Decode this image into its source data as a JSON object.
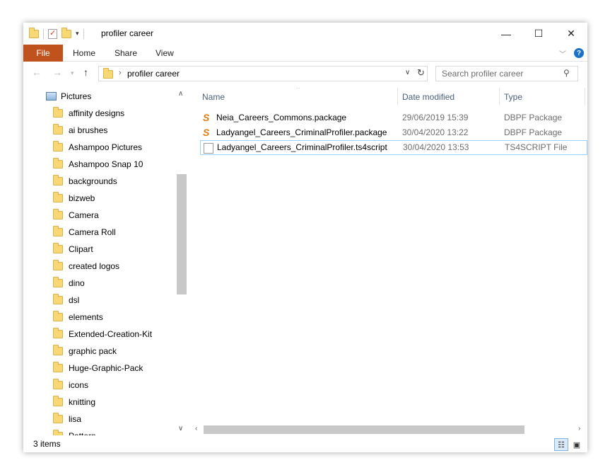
{
  "window": {
    "title": "profiler career",
    "controls": {
      "minimize": "—",
      "maximize": "☐",
      "close": "✕"
    }
  },
  "ribbon": {
    "file_tab": "File",
    "tabs": [
      "Home",
      "Share",
      "View"
    ]
  },
  "address": {
    "path": "profiler career",
    "search_placeholder": "Search profiler career"
  },
  "nav": {
    "root": "Pictures",
    "folders": [
      "affinity designs",
      "ai brushes",
      "Ashampoo Pictures",
      "Ashampoo Snap 10",
      "backgrounds",
      "bizweb",
      "Camera",
      "Camera Roll",
      "Clipart",
      "created logos",
      "dino",
      "dsl",
      "elements",
      "Extended-Creation-Kit",
      "graphic pack",
      "Huge-Graphic-Pack",
      "icons",
      "knitting",
      "lisa",
      "Pattern"
    ]
  },
  "columns": {
    "name": "Name",
    "date": "Date modified",
    "type": "Type"
  },
  "files": [
    {
      "name": "Neia_Careers_Commons.package",
      "date": "29/06/2019 15:39",
      "type": "DBPF Package",
      "icon": "sims-package-icon"
    },
    {
      "name": "Ladyangel_Careers_CriminalProfiler.package",
      "date": "30/04/2020 13:22",
      "type": "DBPF Package",
      "icon": "sims-package-icon"
    },
    {
      "name": "Ladyangel_Careers_CriminalProfiler.ts4script",
      "date": "30/04/2020 13:53",
      "type": "TS4SCRIPT File",
      "icon": "document-icon"
    }
  ],
  "status": {
    "item_count": "3 items"
  },
  "colors": {
    "file_tab": "#c0521e",
    "selection_border": "#99d1ff",
    "header_text": "#4c607a",
    "help": "#1b72c9"
  }
}
